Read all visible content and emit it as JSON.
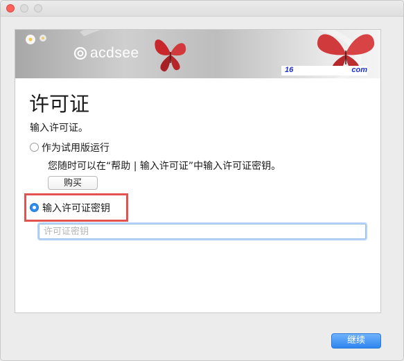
{
  "window": {
    "controls": [
      "close",
      "minimize",
      "maximize"
    ]
  },
  "banner": {
    "brand": "acdsee",
    "link_left": "16",
    "link_right": "com"
  },
  "page": {
    "title": "许可证",
    "subtitle": "输入许可证。"
  },
  "options": {
    "trial_label": "作为试用版运行",
    "trial_description": "您随时可以在“帮助 | 输入许可证”中输入许可证密钥。",
    "buy_label": "购买",
    "license_label": "输入许可证密钥",
    "selected": "license"
  },
  "license_input": {
    "value": "",
    "placeholder": "许可证密钥"
  },
  "footer": {
    "continue_label": "继续"
  },
  "colors": {
    "accent": "#2f86f0",
    "highlight": "#e2524f",
    "close": "#fc605b",
    "link": "#1d2fd0"
  }
}
